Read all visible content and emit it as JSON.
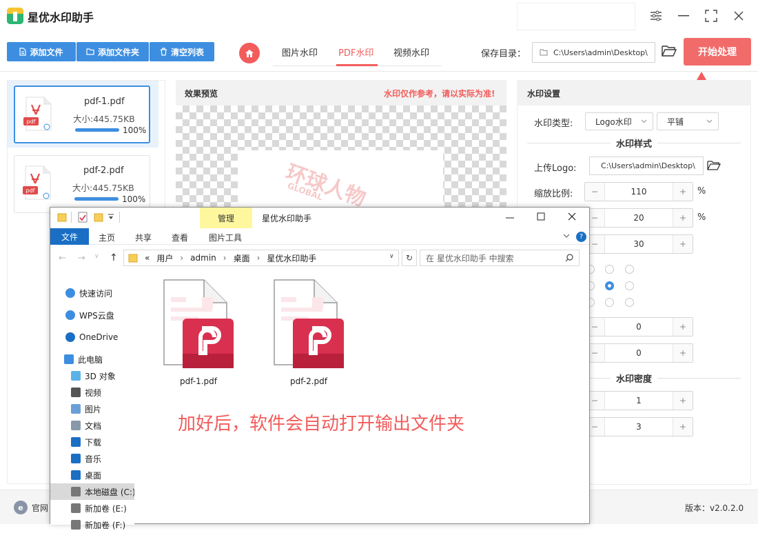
{
  "app": {
    "title": "星优水印助手"
  },
  "toolbar": {
    "add_file": "添加文件",
    "add_folder": "添加文件夹",
    "clear_list": "清空列表",
    "tabs": [
      "图片水印",
      "PDF水印",
      "视频水印"
    ],
    "active_tab": "PDF水印",
    "save_label": "保存目录：",
    "save_path": "C:\\Users\\admin\\Desktop\\",
    "start": "开始处理"
  },
  "files": [
    {
      "name": "pdf-1.pdf",
      "size": "大小:445.75KB",
      "percent": "100%",
      "progress": 1.0
    },
    {
      "name": "pdf-2.pdf",
      "size": "大小:445.75KB",
      "percent": "100%",
      "progress": 1.0
    }
  ],
  "preview": {
    "title": "效果预览",
    "warning": "水印仅作参考，请以实际为准!",
    "watermark_text": "环球人物",
    "watermark_sub": "GLOBAL"
  },
  "settings": {
    "title": "水印设置",
    "type_label": "水印类型:",
    "type_value": "Logo水印",
    "tile_value": "平铺",
    "style_section": "水印样式",
    "logo_label": "上传Logo:",
    "logo_path": "C:\\Users\\admin\\Desktop\\",
    "scale_label": "缩放比例:",
    "scale_value": "110",
    "unit_percent": "%",
    "opacity_value": "20",
    "rotate_value": "30",
    "offset_x_value": "0",
    "offset_y_value": "0",
    "density_section": "水印密度",
    "density_row_value": "1",
    "density_col_value": "3"
  },
  "bottom": {
    "website": "官网",
    "version": "版本：v2.0.2.0"
  },
  "explorer": {
    "title": "星优水印助手",
    "manage": "管理",
    "tabs": [
      "文件",
      "主页",
      "共享",
      "查看",
      "图片工具"
    ],
    "path": [
      "«",
      "用户",
      "admin",
      "桌面",
      "星优水印助手"
    ],
    "search_placeholder": "在 星优水印助手 中搜索",
    "nav": [
      {
        "label": "快速访问",
        "icon": "star-icon"
      },
      {
        "label": "WPS云盘",
        "icon": "cloud-icon"
      },
      {
        "label": "OneDrive",
        "icon": "onedrive-icon"
      },
      {
        "label": "此电脑",
        "icon": "computer-icon"
      },
      {
        "label": "3D 对象",
        "icon": "cube-icon"
      },
      {
        "label": "视频",
        "icon": "video-icon"
      },
      {
        "label": "图片",
        "icon": "picture-icon"
      },
      {
        "label": "文档",
        "icon": "document-icon"
      },
      {
        "label": "下载",
        "icon": "download-icon"
      },
      {
        "label": "音乐",
        "icon": "music-icon"
      },
      {
        "label": "桌面",
        "icon": "desktop-icon"
      },
      {
        "label": "本地磁盘 (C:)",
        "icon": "disk-icon"
      },
      {
        "label": "新加卷 (E:)",
        "icon": "disk-icon"
      },
      {
        "label": "新加卷 (F:)",
        "icon": "disk-icon"
      }
    ],
    "files": [
      "pdf-1.pdf",
      "pdf-2.pdf"
    ],
    "note": "加好后，软件会自动打开输出文件夹"
  },
  "colors": {
    "accent_blue": "#3d8ee0",
    "accent_red": "#f25c5c",
    "pdf_red": "#d9304f"
  }
}
